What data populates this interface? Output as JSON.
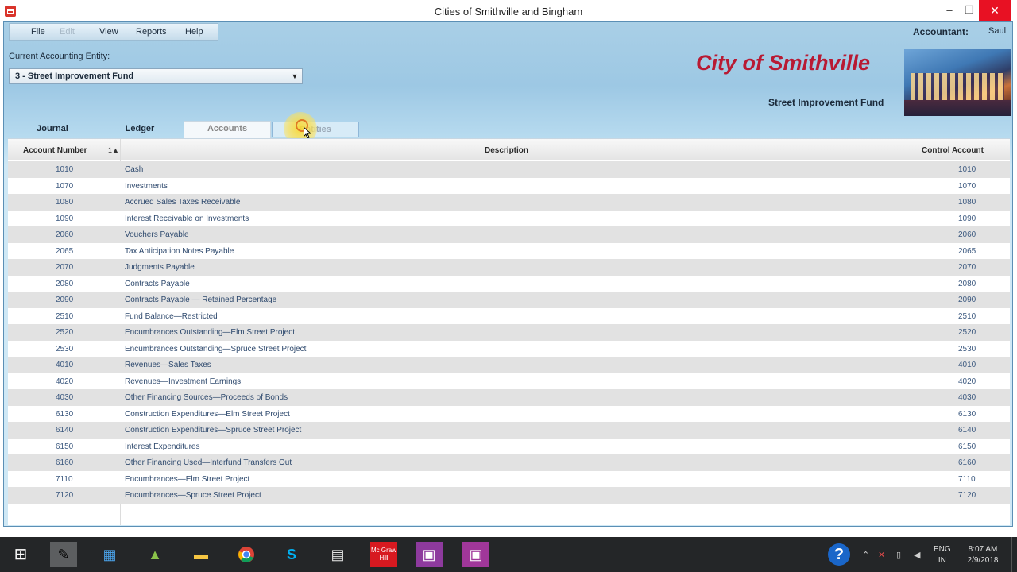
{
  "window": {
    "title": "Cities of Smithville and Bingham",
    "minimize": "–",
    "maximize": "❐",
    "close": "✕"
  },
  "menu": {
    "file": "File",
    "edit": "Edit",
    "view": "View",
    "reports": "Reports",
    "help": "Help"
  },
  "accountant": {
    "label": "Accountant:",
    "name": "Saul"
  },
  "entity": {
    "label": "Current Accounting Entity:",
    "selected": "3 - Street Improvement Fund",
    "arrow": "▼"
  },
  "header": {
    "city": "City of Smithville",
    "fund": "Street Improvement Fund"
  },
  "tabs": {
    "journal": "Journal",
    "ledger": "Ledger",
    "accounts": "Accounts",
    "entities": "Entities"
  },
  "grid": {
    "columns": {
      "account_number": "Account Number",
      "sort": "1▲",
      "description": "Description",
      "control_account": "Control Account"
    },
    "rows": [
      {
        "number": "1010",
        "description": "Cash",
        "control": "1010"
      },
      {
        "number": "1070",
        "description": "Investments",
        "control": "1070"
      },
      {
        "number": "1080",
        "description": "Accrued Sales Taxes Receivable",
        "control": "1080"
      },
      {
        "number": "1090",
        "description": "Interest Receivable on Investments",
        "control": "1090"
      },
      {
        "number": "2060",
        "description": "Vouchers Payable",
        "control": "2060"
      },
      {
        "number": "2065",
        "description": "Tax Anticipation Notes Payable",
        "control": "2065"
      },
      {
        "number": "2070",
        "description": "Judgments Payable",
        "control": "2070"
      },
      {
        "number": "2080",
        "description": "Contracts Payable",
        "control": "2080"
      },
      {
        "number": "2090",
        "description": "Contracts Payable — Retained Percentage",
        "control": "2090"
      },
      {
        "number": "2510",
        "description": "Fund Balance—Restricted",
        "control": "2510"
      },
      {
        "number": "2520",
        "description": "Encumbrances Outstanding—Elm Street Project",
        "control": "2520"
      },
      {
        "number": "2530",
        "description": "Encumbrances Outstanding—Spruce Street Project",
        "control": "2530"
      },
      {
        "number": "4010",
        "description": "Revenues—Sales Taxes",
        "control": "4010"
      },
      {
        "number": "4020",
        "description": "Revenues—Investment Earnings",
        "control": "4020"
      },
      {
        "number": "4030",
        "description": "Other Financing Sources—Proceeds of Bonds",
        "control": "4030"
      },
      {
        "number": "6130",
        "description": "Construction Expenditures—Elm Street Project",
        "control": "6130"
      },
      {
        "number": "6140",
        "description": "Construction Expenditures—Spruce Street Project",
        "control": "6140"
      },
      {
        "number": "6150",
        "description": "Interest Expenditures",
        "control": "6150"
      },
      {
        "number": "6160",
        "description": "Other Financing Used—Interfund Transfers Out",
        "control": "6160"
      },
      {
        "number": "7110",
        "description": "Encumbrances—Elm Street Project",
        "control": "7110"
      },
      {
        "number": "7120",
        "description": "Encumbrances—Spruce Street Project",
        "control": "7120"
      }
    ]
  },
  "taskbar": {
    "icons": [
      "windows-start-icon",
      "cortana-icon",
      "apps-grid-icon",
      "android-studio-icon",
      "file-explorer-icon",
      "chrome-icon",
      "skype-icon",
      "files-icon",
      "mcgraw-hill-icon",
      "teams-icon",
      "teams-icon"
    ],
    "mcgraw_text": "Mc Graw Hill",
    "skype_letter": "S",
    "help_glyph": "?",
    "lang_top": "ENG",
    "lang_bottom": "IN",
    "time": "8:07 AM",
    "date": "2/9/2018"
  }
}
